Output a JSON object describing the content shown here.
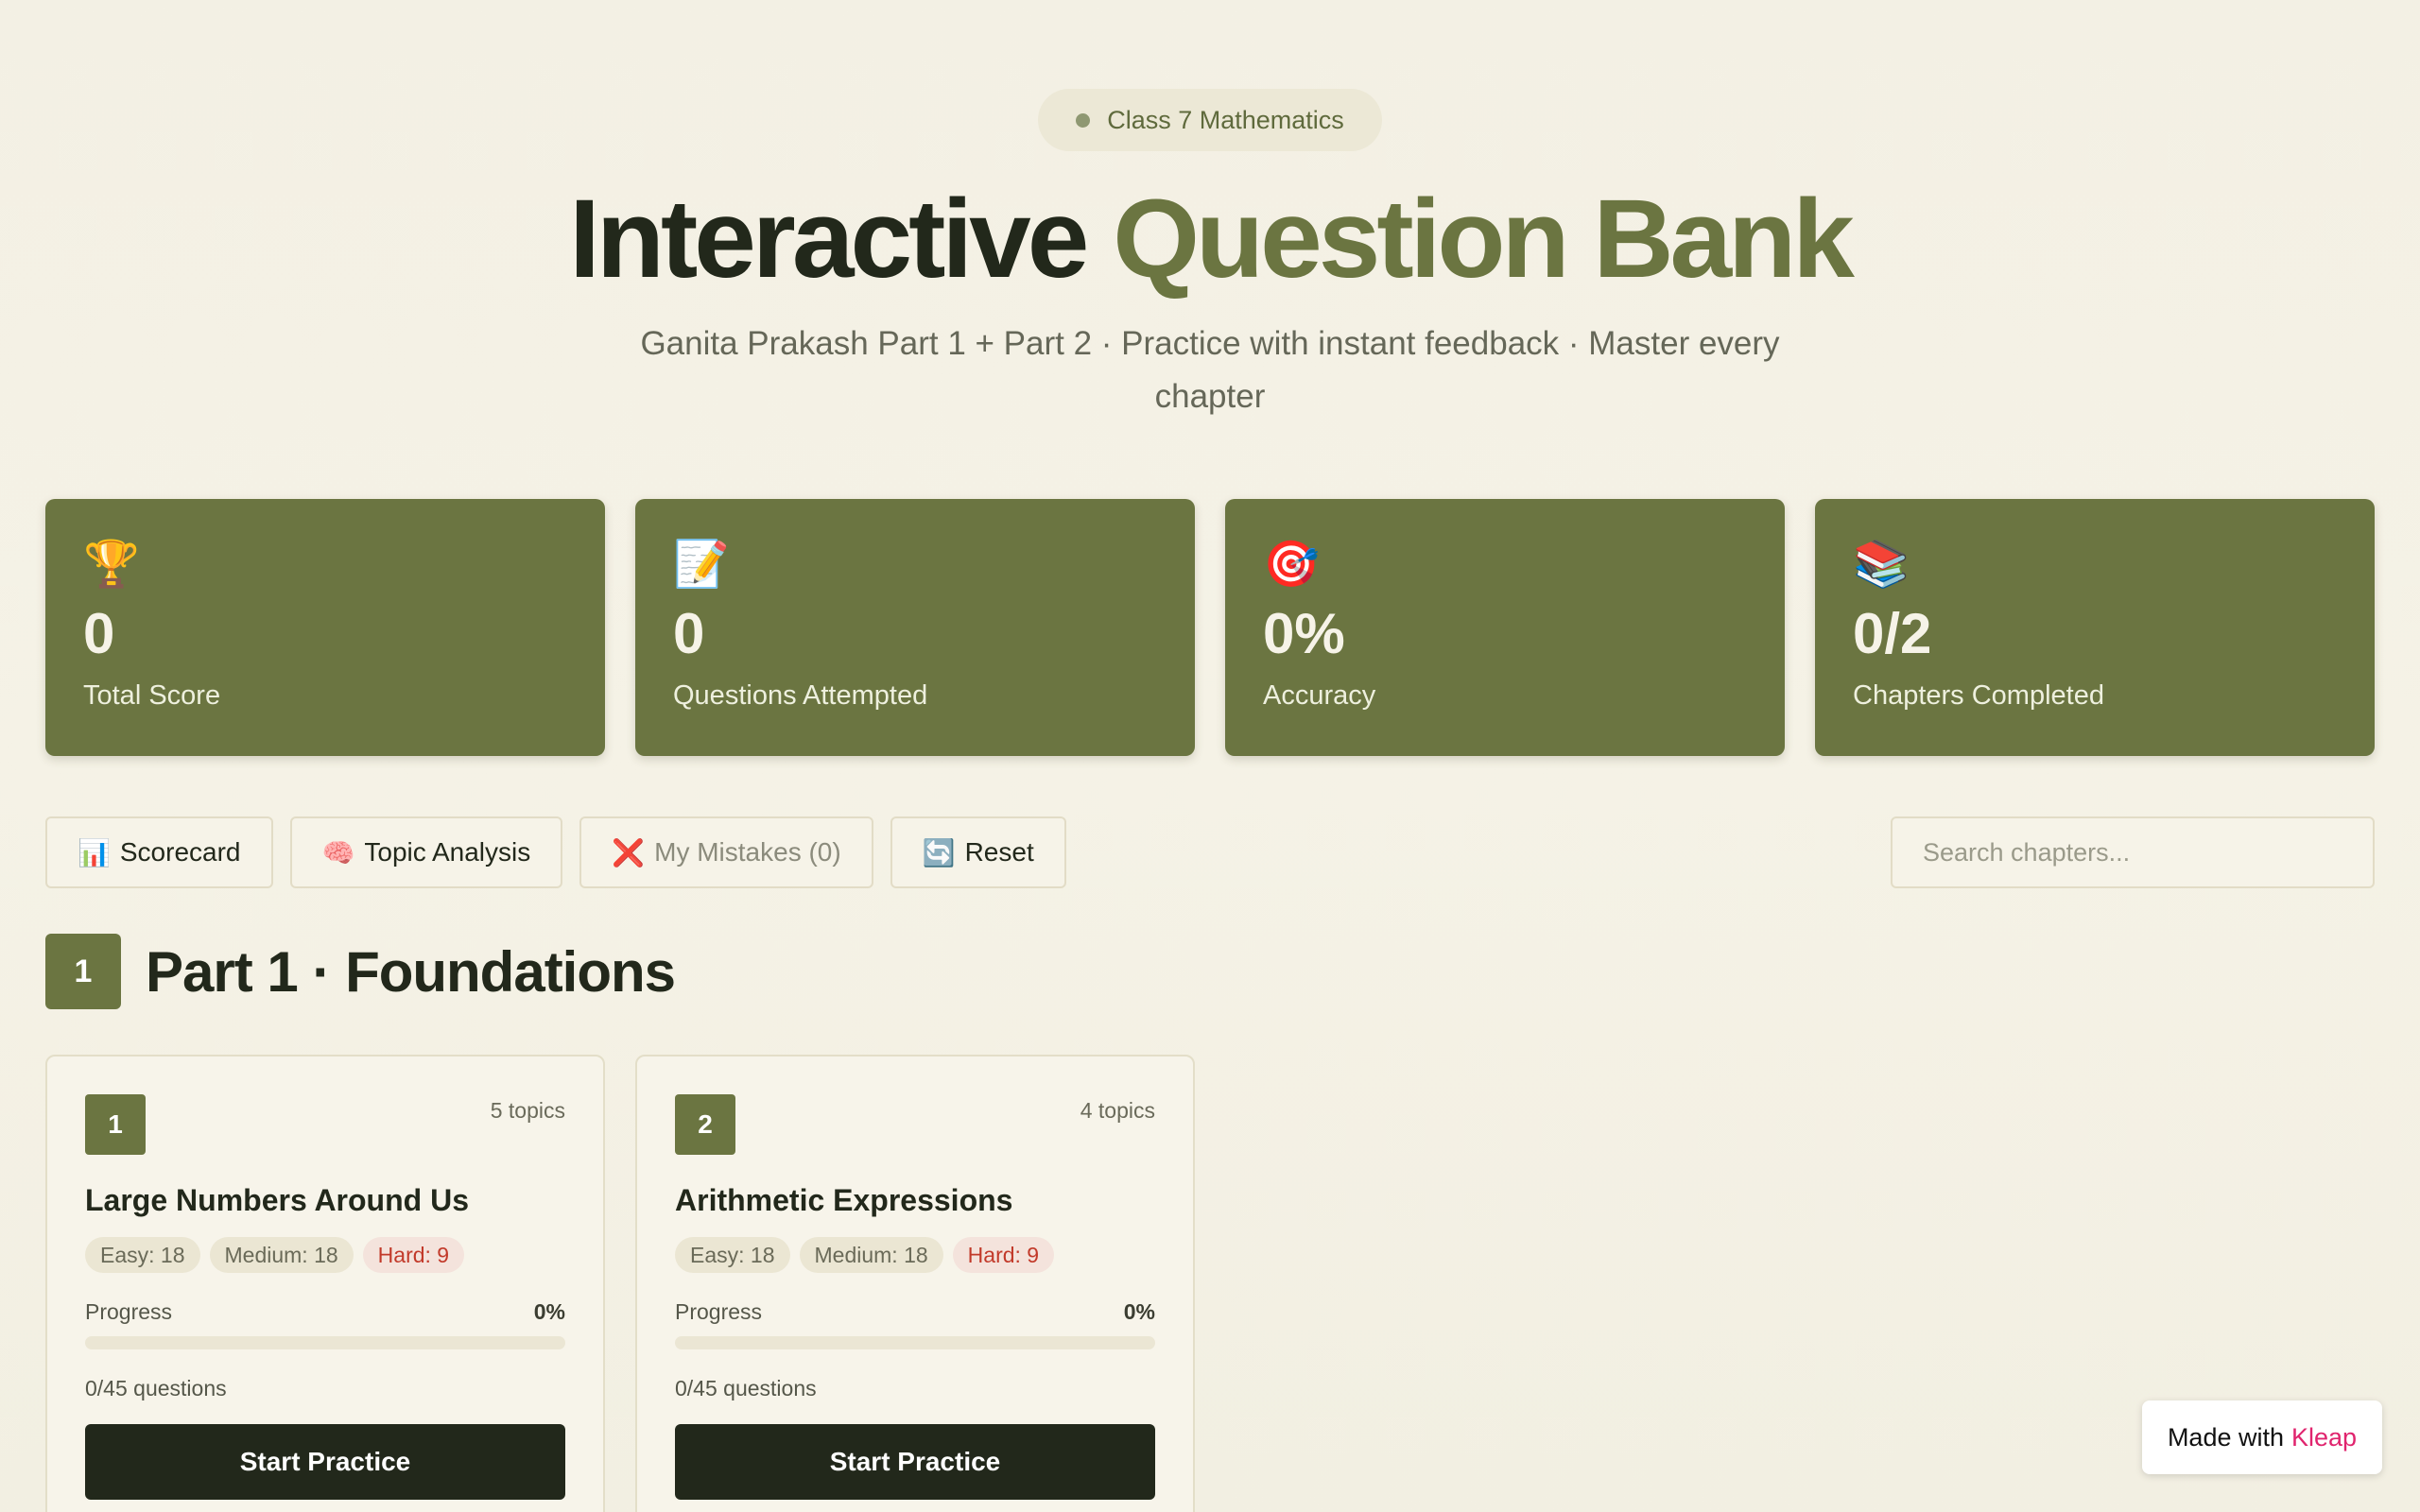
{
  "header": {
    "pill": "Class 7 Mathematics",
    "title_main": "Interactive",
    "title_accent": "Question Bank",
    "subtitle": "Ganita Prakash Part 1 + Part 2 · Practice with instant feedback · Master every chapter"
  },
  "stats": [
    {
      "icon": "🏆",
      "value": "0",
      "label": "Total Score"
    },
    {
      "icon": "📝",
      "value": "0",
      "label": "Questions Attempted"
    },
    {
      "icon": "🎯",
      "value": "0%",
      "label": "Accuracy"
    },
    {
      "icon": "📚",
      "value": "0/2",
      "label": "Chapters Completed"
    }
  ],
  "toolbar": {
    "scorecard": {
      "icon": "📊",
      "label": "Scorecard"
    },
    "topic_analysis": {
      "icon": "🧠",
      "label": "Topic Analysis"
    },
    "mistakes": {
      "icon": "❌",
      "label": "My Mistakes (0)"
    },
    "reset": {
      "icon": "🔄",
      "label": "Reset"
    },
    "search_placeholder": "Search chapters..."
  },
  "part": {
    "number": "1",
    "title": "Part 1 · Foundations"
  },
  "chapters": [
    {
      "number": "1",
      "topics": "5 topics",
      "title": "Large Numbers Around Us",
      "easy": "Easy: 18",
      "medium": "Medium: 18",
      "hard": "Hard: 9",
      "progress_label": "Progress",
      "progress_pct": "0%",
      "progress_value": 0,
      "questions": "0/45 questions",
      "button": "Start Practice"
    },
    {
      "number": "2",
      "topics": "4 topics",
      "title": "Arithmetic Expressions",
      "easy": "Easy: 18",
      "medium": "Medium: 18",
      "hard": "Hard: 9",
      "progress_label": "Progress",
      "progress_pct": "0%",
      "progress_value": 0,
      "questions": "0/45 questions",
      "button": "Start Practice"
    }
  ],
  "footer": {
    "made_with": "Made with",
    "brand": "Kleap"
  },
  "colors": {
    "accent": "#6b7541",
    "dark": "#22281b",
    "hard": "#c23a2a",
    "brand": "#e0246e"
  }
}
